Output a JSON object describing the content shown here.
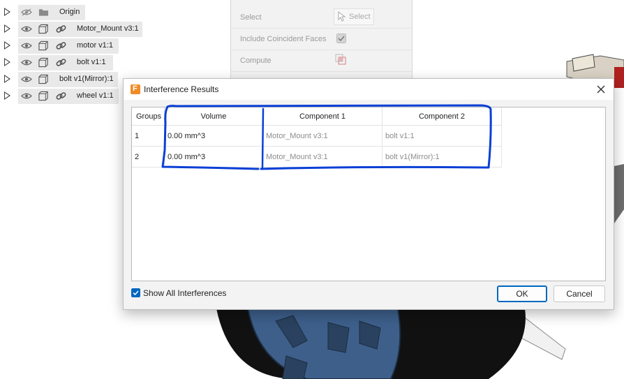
{
  "browser": {
    "items": [
      {
        "label": "Origin",
        "icon": "folder-icon",
        "visible": false
      },
      {
        "label": "Motor_Mount v3:1",
        "icon": "link-icon",
        "visible": true
      },
      {
        "label": "motor v1:1",
        "icon": "link-icon",
        "visible": true
      },
      {
        "label": "bolt v1:1",
        "icon": "link-icon",
        "visible": true
      },
      {
        "label": "bolt v1(Mirror):1",
        "icon": "component-icon",
        "visible": true
      },
      {
        "label": "wheel v1:1",
        "icon": "link-icon",
        "visible": true
      }
    ]
  },
  "palette": {
    "select_label": "Select",
    "select_button": "Select",
    "coincident_label": "Include Coincident Faces",
    "compute_label": "Compute"
  },
  "dialog": {
    "title": "Interference Results",
    "columns": [
      "Groups",
      "Volume",
      "Component 1",
      "Component 2"
    ],
    "rows": [
      {
        "group": "1",
        "volume": "0.00 mm^3",
        "component1": "Motor_Mount v3:1",
        "component2": "bolt v1:1"
      },
      {
        "group": "2",
        "volume": "0.00 mm^3",
        "component1": "Motor_Mount v3:1",
        "component2": "bolt v1(Mirror):1"
      }
    ],
    "show_all_label": "Show All Interferences",
    "show_all_checked": true,
    "ok_label": "OK",
    "cancel_label": "Cancel"
  },
  "colors": {
    "accent": "#0067c0",
    "app_icon": "#f08c28",
    "annotation": "#0a3fd6",
    "wheel_hub": "#3d5f8a"
  }
}
